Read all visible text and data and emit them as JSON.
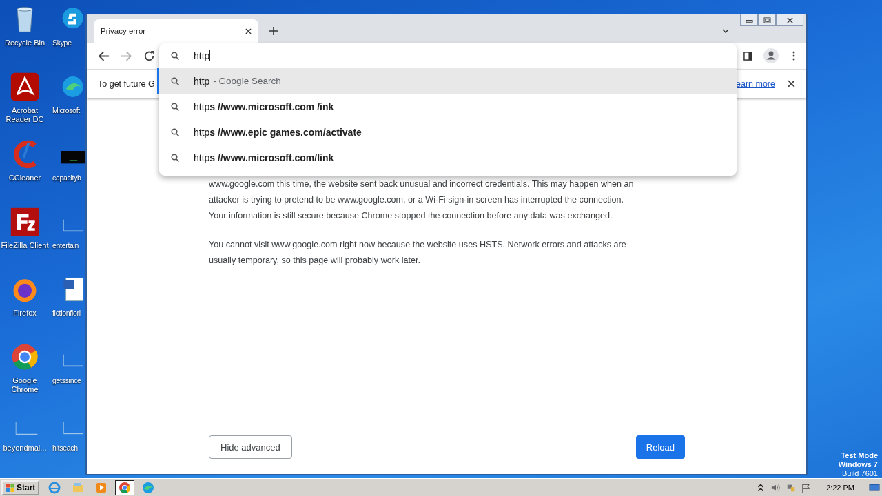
{
  "desktop_icons": [
    {
      "label": "Recycle Bin"
    },
    {
      "label": "Skype"
    },
    {
      "label": "Acrobat Reader DC"
    },
    {
      "label": "Microsoft"
    },
    {
      "label": "CCleaner"
    },
    {
      "label": "capacityb"
    },
    {
      "label": "FileZilla Client"
    },
    {
      "label": "entertain"
    },
    {
      "label": "Firefox"
    },
    {
      "label": "fictionflori"
    },
    {
      "label": "Google Chrome"
    },
    {
      "label": "getssince"
    },
    {
      "label": "beyondmai..."
    },
    {
      "label": "hitseach"
    }
  ],
  "browser": {
    "tab": {
      "title": "Privacy error"
    },
    "omnibox": {
      "value": "http"
    },
    "suggestions": [
      {
        "text": "http",
        "suffix": "- Google Search",
        "selected": true
      },
      {
        "text": "http**s //www.microsoft.com /ink**",
        "selected": false
      },
      {
        "text": "http**s //www.epic games.com/activate**",
        "selected": false
      },
      {
        "text": "http**s //www.microsoft.com/link**",
        "selected": false
      }
    ],
    "forward_disabled": true,
    "infobar": {
      "text": "To get future G",
      "link": "earn more"
    },
    "paragraphs": [
      [
        "www.google.com this time, the website sent back unusual and incorrect credentials. This may happen when an",
        "attacker is trying to pretend to be www.google.com, or a Wi-Fi sign-in screen has interrupted the connection.",
        "Your information is still secure because Chrome stopped the connection before any data was exchanged."
      ],
      [
        "You cannot visit www.google.com right now because the website uses HSTS. Network errors and attacks are",
        "usually temporary, so this page will probably work later."
      ]
    ],
    "buttons": {
      "secondary": "Hide advanced",
      "primary": "Reload"
    }
  },
  "os_notice": [
    "Test Mode",
    "Windows 7",
    "Build 7601"
  ],
  "taskbar": {
    "start": "Start",
    "apps": [
      {
        "selected": false
      },
      {
        "selected": false
      },
      {
        "selected": false
      },
      {
        "selected": true
      },
      {
        "selected": false
      }
    ],
    "clock": "2:22 PM"
  }
}
